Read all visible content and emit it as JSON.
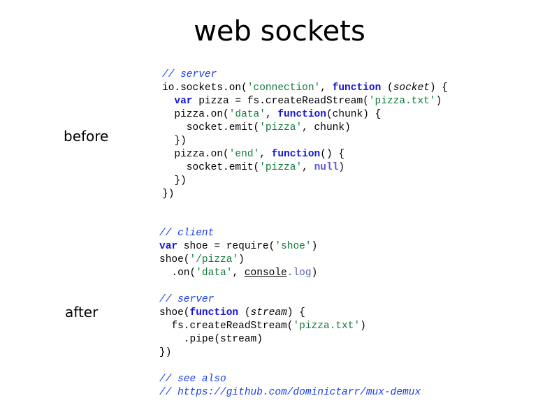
{
  "slide": {
    "title": "web sockets",
    "before_label": "before",
    "after_label": "after"
  },
  "before_code": {
    "l1": "// server",
    "l2": {
      "a": "io.sockets.on(",
      "b": "'connection'",
      "c": ", ",
      "d": "function",
      "e": " (",
      "f": "socket",
      "g": ") {"
    },
    "l3": {
      "a": "  ",
      "b": "var",
      "c": " pizza = fs.createReadStream(",
      "d": "'pizza.txt'",
      "e": ")"
    },
    "l4": {
      "a": "  pizza.on(",
      "b": "'data'",
      "c": ", ",
      "d": "function",
      "e": "(chunk) {"
    },
    "l5": {
      "a": "    socket.emit(",
      "b": "'pizza'",
      "c": ", chunk)"
    },
    "l6": "  })",
    "l7": {
      "a": "  pizza.on(",
      "b": "'end'",
      "c": ", ",
      "d": "function",
      "e": "() {"
    },
    "l8": {
      "a": "    socket.emit(",
      "b": "'pizza'",
      "c": ", ",
      "d": "null",
      "e": ")"
    },
    "l9": "  })",
    "l10": "})"
  },
  "after_code": {
    "l1": "// client",
    "l2": {
      "a": "var",
      "b": " shoe = require(",
      "c": "'shoe'",
      "d": ")"
    },
    "l3": {
      "a": "shoe(",
      "b": "'/pizza'",
      "c": ")"
    },
    "l4": {
      "a": "  .on(",
      "b": "'data'",
      "c": ", ",
      "d": "console",
      "e": ".log",
      "f": ")"
    },
    "l5": "",
    "l6": "// server",
    "l7": {
      "a": "shoe(",
      "b": "function",
      "c": " (",
      "d": "stream",
      "e": ") {"
    },
    "l8": {
      "a": "  fs.createReadStream(",
      "b": "'pizza.txt'",
      "c": ")"
    },
    "l9": "    .pipe(stream)",
    "l10": "})",
    "l11": "",
    "l12": "// see also",
    "l13": "// https://github.com/dominictarr/mux-demux"
  }
}
